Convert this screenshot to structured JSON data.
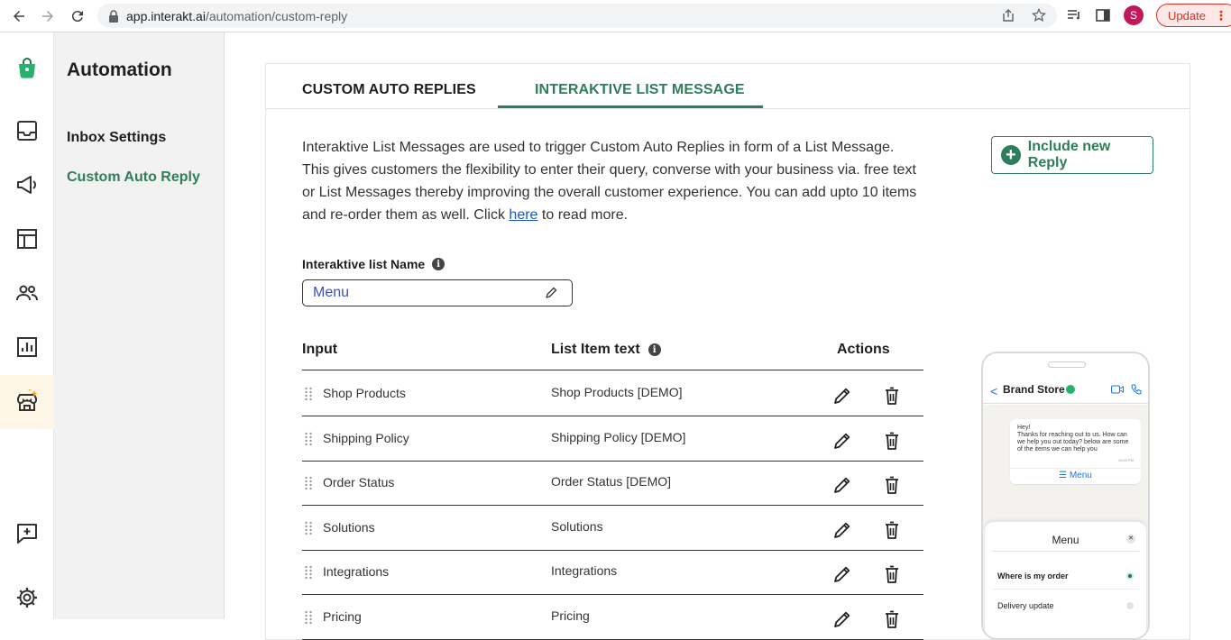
{
  "browser": {
    "url_host": "app.interakt.ai",
    "url_path": "/automation/custom-reply",
    "profile_initial": "S",
    "update_label": "Update",
    "update_menu": "⋮"
  },
  "sidebar": {
    "title": "Automation",
    "items": [
      {
        "label": "Inbox Settings"
      },
      {
        "label": "Custom Auto Reply"
      }
    ]
  },
  "tabs": [
    {
      "label": "CUSTOM AUTO REPLIES"
    },
    {
      "label": "INTERAKTIVE LIST MESSAGE"
    }
  ],
  "description": {
    "text_before": "Interaktive List Messages are used to trigger Custom Auto Replies in form of a List Message. This gives customers the flexibility to enter their query, converse with your business via. free text or List Messages thereby improving the overall customer experience. You can add upto 10 items and re-order them as well. Click ",
    "link": "here",
    "text_after": " to read more."
  },
  "include_button": {
    "icon": "+",
    "label": "Include new Reply"
  },
  "list_name": {
    "label": "Interaktive list Name",
    "info": "i",
    "value": "Menu"
  },
  "table": {
    "headers": {
      "input": "Input",
      "text": "List Item text",
      "info": "i",
      "actions": "Actions"
    },
    "rows": [
      {
        "input": "Shop Products",
        "text": "Shop Products [DEMO]"
      },
      {
        "input": "Shipping Policy",
        "text": "Shipping Policy [DEMO]"
      },
      {
        "input": "Order Status",
        "text": "Order Status [DEMO]"
      },
      {
        "input": "Solutions",
        "text": "Solutions"
      },
      {
        "input": "Integrations",
        "text": "Integrations"
      },
      {
        "input": "Pricing",
        "text": "Pricing"
      }
    ]
  },
  "phone": {
    "back": "<",
    "brand_name": "Brand Store",
    "message_lines": [
      "Hey!",
      "Thanks for reaching out to us. How can",
      "we help you out today? below are some",
      "of the items we can help you"
    ],
    "time": "10:00 PM",
    "menu_link": "☰ Menu",
    "sheet_title": "Menu",
    "sheet_close": "✕",
    "options": [
      "Where is my order",
      "Delivery update"
    ]
  },
  "colors": {
    "brand_green": "#2e7d5b",
    "link_blue": "#1a55c8",
    "input_text": "#3f51b5"
  }
}
